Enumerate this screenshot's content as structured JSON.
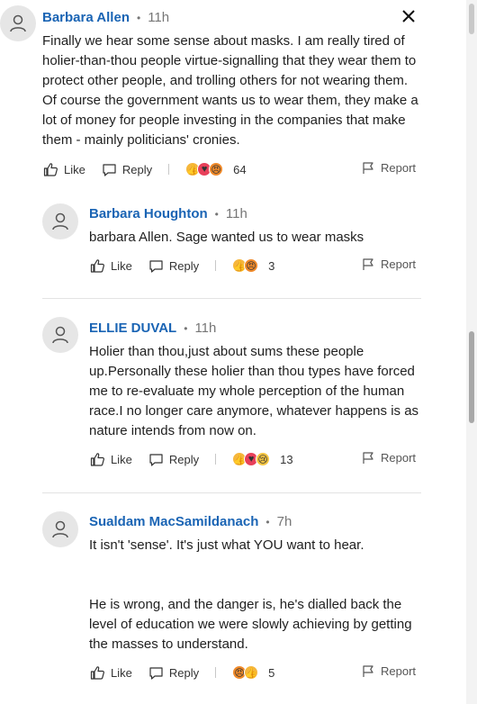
{
  "close_label": "Close",
  "comments": [
    {
      "author": "Barbara Allen",
      "separator": "•",
      "time": "11h",
      "paragraphs": [
        "Finally we hear some sense about masks. I am really tired of holier-than-thou people virtue-signalling that they wear them to protect other people, and trolling others for not wearing them. Of course the government wants us to wear them, they make a lot of money for people investing in the companies that make them - mainly politicians' cronies."
      ],
      "like_label": "Like",
      "reply_label": "Reply",
      "reactions": [
        "like",
        "love",
        "angry"
      ],
      "reaction_count": "64",
      "report_label": "Report"
    },
    {
      "author": "Barbara Houghton",
      "separator": "•",
      "time": "11h",
      "paragraphs": [
        "barbara Allen. Sage wanted us to wear masks"
      ],
      "like_label": "Like",
      "reply_label": "Reply",
      "reactions": [
        "like",
        "angry"
      ],
      "reaction_count": "3",
      "report_label": "Report"
    },
    {
      "author": "ELLIE DUVAL",
      "separator": "•",
      "time": "11h",
      "paragraphs": [
        "Holier than thou,just about sums these people up.Personally these holier than thou types have forced me to re-evaluate my whole perception of the human race.I no longer care anymore, whatever happens is as nature intends from now on."
      ],
      "like_label": "Like",
      "reply_label": "Reply",
      "reactions": [
        "like",
        "love",
        "sad"
      ],
      "reaction_count": "13",
      "report_label": "Report"
    },
    {
      "author": "Sualdam MacSamildanach",
      "separator": "•",
      "time": "7h",
      "paragraphs": [
        "It isn't 'sense'. It's just what YOU want to hear.",
        "He is wrong, and the danger is, he's dialled back the level of education we were slowly achieving by getting the masses to understand."
      ],
      "like_label": "Like",
      "reply_label": "Reply",
      "reactions": [
        "angry",
        "like"
      ],
      "reaction_count": "5",
      "report_label": "Report"
    }
  ],
  "colors": {
    "author": "#1a64b4",
    "meta": "#767676",
    "divider": "#e3e3e3"
  }
}
